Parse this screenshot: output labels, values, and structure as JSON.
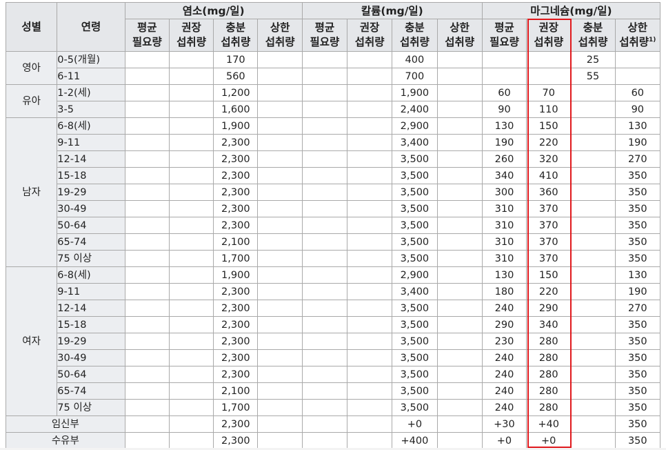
{
  "header": {
    "sex": "성별",
    "age": "연령",
    "groups": [
      "염소(mg/일)",
      "칼륨(mg/일)",
      "마그네슘(mg/일)"
    ],
    "sub": [
      [
        "평균",
        "필요량"
      ],
      [
        "권장",
        "섭취량"
      ],
      [
        "충분",
        "섭취량"
      ],
      [
        "상한",
        "섭취량"
      ],
      [
        "평균",
        "필요량"
      ],
      [
        "권장",
        "섭취량"
      ],
      [
        "충분",
        "섭취량"
      ],
      [
        "상한",
        "섭취량"
      ],
      [
        "평균",
        "필요량"
      ],
      [
        "권장",
        "섭취량"
      ],
      [
        "충분",
        "섭취량"
      ],
      [
        "상한",
        "섭취량"
      ]
    ],
    "footnote_mark": "1)"
  },
  "groups": [
    {
      "sex": "영아",
      "rows": [
        {
          "age": "0-5(개월)",
          "v": [
            "",
            "",
            "170",
            "",
            "",
            "",
            "400",
            "",
            "",
            "",
            "25",
            ""
          ]
        },
        {
          "age": "6-11",
          "v": [
            "",
            "",
            "560",
            "",
            "",
            "",
            "700",
            "",
            "",
            "",
            "55",
            ""
          ]
        }
      ]
    },
    {
      "sex": "유아",
      "rows": [
        {
          "age": "1-2(세)",
          "v": [
            "",
            "",
            "1,200",
            "",
            "",
            "",
            "1,900",
            "",
            "60",
            "70",
            "",
            "60"
          ]
        },
        {
          "age": "3-5",
          "v": [
            "",
            "",
            "1,600",
            "",
            "",
            "",
            "2,400",
            "",
            "90",
            "110",
            "",
            "90"
          ]
        }
      ]
    },
    {
      "sex": "남자",
      "rows": [
        {
          "age": "6-8(세)",
          "v": [
            "",
            "",
            "1,900",
            "",
            "",
            "",
            "2,900",
            "",
            "130",
            "150",
            "",
            "130"
          ]
        },
        {
          "age": "9-11",
          "v": [
            "",
            "",
            "2,300",
            "",
            "",
            "",
            "3,400",
            "",
            "190",
            "220",
            "",
            "190"
          ]
        },
        {
          "age": "12-14",
          "v": [
            "",
            "",
            "2,300",
            "",
            "",
            "",
            "3,500",
            "",
            "260",
            "320",
            "",
            "270"
          ]
        },
        {
          "age": "15-18",
          "v": [
            "",
            "",
            "2,300",
            "",
            "",
            "",
            "3,500",
            "",
            "340",
            "410",
            "",
            "350"
          ]
        },
        {
          "age": "19-29",
          "v": [
            "",
            "",
            "2,300",
            "",
            "",
            "",
            "3,500",
            "",
            "300",
            "360",
            "",
            "350"
          ]
        },
        {
          "age": "30-49",
          "v": [
            "",
            "",
            "2,300",
            "",
            "",
            "",
            "3,500",
            "",
            "310",
            "370",
            "",
            "350"
          ]
        },
        {
          "age": "50-64",
          "v": [
            "",
            "",
            "2,300",
            "",
            "",
            "",
            "3,500",
            "",
            "310",
            "370",
            "",
            "350"
          ]
        },
        {
          "age": "65-74",
          "v": [
            "",
            "",
            "2,100",
            "",
            "",
            "",
            "3,500",
            "",
            "310",
            "370",
            "",
            "350"
          ]
        },
        {
          "age": "75 이상",
          "v": [
            "",
            "",
            "1,700",
            "",
            "",
            "",
            "3,500",
            "",
            "310",
            "370",
            "",
            "350"
          ]
        }
      ]
    },
    {
      "sex": "여자",
      "rows": [
        {
          "age": "6-8(세)",
          "v": [
            "",
            "",
            "1,900",
            "",
            "",
            "",
            "2,900",
            "",
            "130",
            "150",
            "",
            "130"
          ]
        },
        {
          "age": "9-11",
          "v": [
            "",
            "",
            "2,300",
            "",
            "",
            "",
            "3,400",
            "",
            "180",
            "220",
            "",
            "190"
          ]
        },
        {
          "age": "12-14",
          "v": [
            "",
            "",
            "2,300",
            "",
            "",
            "",
            "3,500",
            "",
            "240",
            "290",
            "",
            "270"
          ]
        },
        {
          "age": "15-18",
          "v": [
            "",
            "",
            "2,300",
            "",
            "",
            "",
            "3,500",
            "",
            "290",
            "340",
            "",
            "350"
          ]
        },
        {
          "age": "19-29",
          "v": [
            "",
            "",
            "2,300",
            "",
            "",
            "",
            "3,500",
            "",
            "230",
            "280",
            "",
            "350"
          ]
        },
        {
          "age": "30-49",
          "v": [
            "",
            "",
            "2,300",
            "",
            "",
            "",
            "3,500",
            "",
            "240",
            "280",
            "",
            "350"
          ]
        },
        {
          "age": "50-64",
          "v": [
            "",
            "",
            "2,300",
            "",
            "",
            "",
            "3,500",
            "",
            "240",
            "280",
            "",
            "350"
          ]
        },
        {
          "age": "65-74",
          "v": [
            "",
            "",
            "2,100",
            "",
            "",
            "",
            "3,500",
            "",
            "240",
            "280",
            "",
            "350"
          ]
        },
        {
          "age": "75 이상",
          "v": [
            "",
            "",
            "1,700",
            "",
            "",
            "",
            "3,500",
            "",
            "240",
            "280",
            "",
            "350"
          ]
        }
      ]
    }
  ],
  "special": [
    {
      "label": "임신부",
      "v": [
        "",
        "",
        "2,300",
        "",
        "",
        "",
        "+0",
        "",
        "+30",
        "+40",
        "",
        "350"
      ]
    },
    {
      "label": "수유부",
      "v": [
        "",
        "",
        "2,300",
        "",
        "",
        "",
        "+400",
        "",
        "+0",
        "+0",
        "",
        "350"
      ]
    }
  ],
  "highlight_color": "#e0181c",
  "header_bg": "#e5e7ea",
  "label_bg": "#eceef1"
}
